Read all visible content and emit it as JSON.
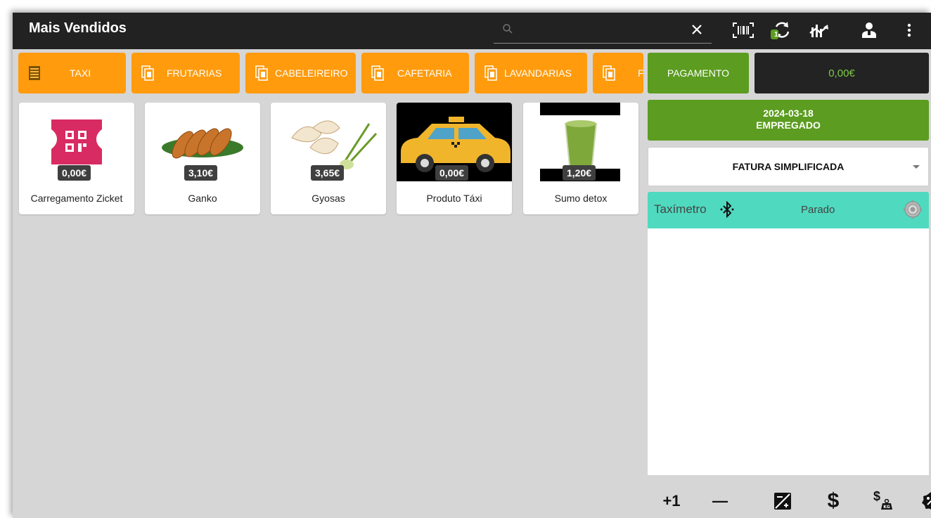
{
  "header": {
    "title": "Mais Vendidos",
    "search_placeholder": "",
    "icons": [
      "search-icon",
      "close-icon",
      "barcode-icon",
      "sync-icon",
      "stats-icon",
      "user-icon",
      "more-icon"
    ],
    "sync_badge": "1"
  },
  "categories": [
    {
      "label": "TAXI",
      "icon": "list-icon"
    },
    {
      "label": "FRUTARIAS",
      "icon": "folder-icon"
    },
    {
      "label": "CABELEIREIRO",
      "icon": "folder-icon"
    },
    {
      "label": "CAFETARIA",
      "icon": "folder-icon"
    },
    {
      "label": "LAVANDARIAS",
      "icon": "folder-icon"
    },
    {
      "label": "F",
      "icon": "folder-icon"
    }
  ],
  "products": [
    {
      "name": "Carregamento Zicket",
      "price": "0,00€"
    },
    {
      "name": "Ganko",
      "price": "3,10€"
    },
    {
      "name": "Gyosas",
      "price": "3,65€"
    },
    {
      "name": "Produto Táxi",
      "price": "0,00€"
    },
    {
      "name": "Sumo detox",
      "price": "1,20€"
    }
  ],
  "order": {
    "pay_label": "PAGAMENTO",
    "total": "0,00€",
    "date": "2024-03-18",
    "employee": "EMPREGADO",
    "doc_type": "FATURA SIMPLIFICADA"
  },
  "taximeter": {
    "label": "Taxímetro",
    "status": "Parado"
  },
  "tools": {
    "plus_one": "+1",
    "minus": "—",
    "dollar": "$",
    "dollar_kg": "$"
  },
  "colors": {
    "orange": "#ff9b0d",
    "green": "#5c9c20",
    "teal": "#4fd9bf",
    "topbar": "#222222"
  }
}
